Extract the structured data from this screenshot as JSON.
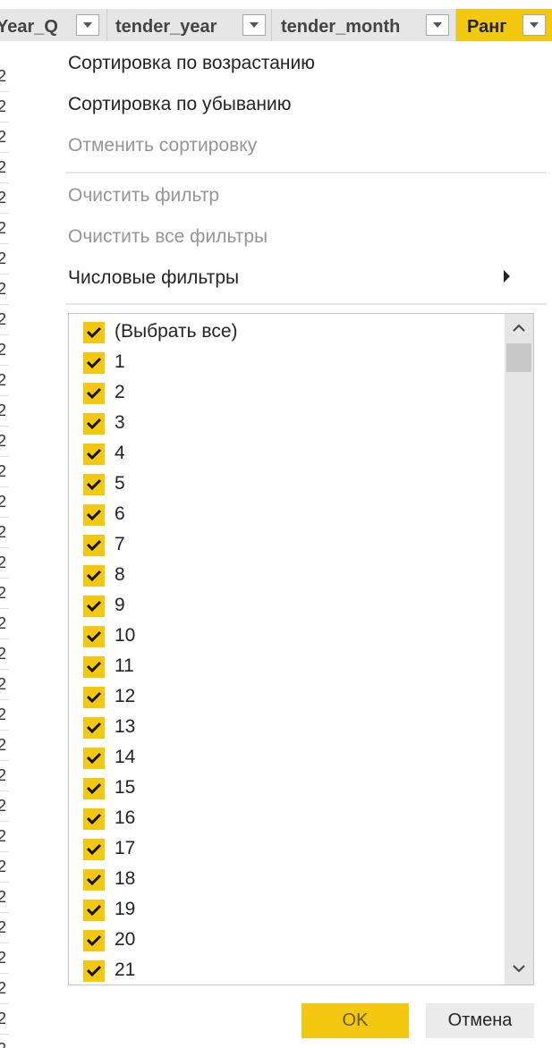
{
  "header": {
    "columns": [
      {
        "label": "Year_Q"
      },
      {
        "label": "tender_year"
      },
      {
        "label": "tender_month"
      },
      {
        "label": "Ранг"
      }
    ]
  },
  "table": {
    "left_cell_digit": "2"
  },
  "menu": {
    "sort_asc": "Сортировка по возрастанию",
    "sort_desc": "Сортировка по убыванию",
    "clear_sort": "Отменить сортировку",
    "clear_filter": "Очистить фильтр",
    "clear_all_filters": "Очистить все фильтры",
    "number_filters": "Числовые фильтры"
  },
  "list": {
    "select_all": "(Выбрать все)",
    "items": [
      "1",
      "2",
      "3",
      "4",
      "5",
      "6",
      "7",
      "8",
      "9",
      "10",
      "11",
      "12",
      "13",
      "14",
      "15",
      "16",
      "17",
      "18",
      "19",
      "20",
      "21"
    ],
    "all_checked": true
  },
  "buttons": {
    "ok": "OK",
    "cancel": "Отмена"
  },
  "colors": {
    "accent": "#f2c811",
    "disabled_text": "#979593",
    "text": "#252423"
  }
}
